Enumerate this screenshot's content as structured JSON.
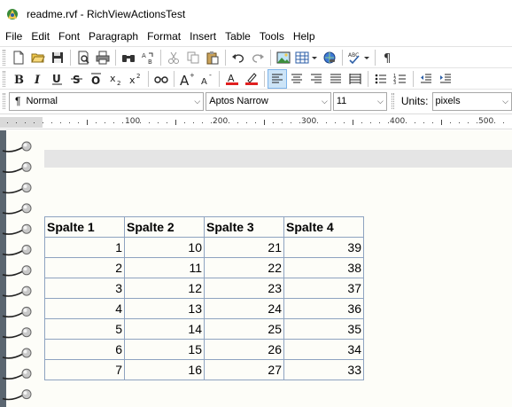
{
  "window": {
    "title": "readme.rvf - RichViewActionsTest"
  },
  "menu": {
    "items": [
      "File",
      "Edit",
      "Font",
      "Paragraph",
      "Format",
      "Insert",
      "Table",
      "Tools",
      "Help"
    ]
  },
  "format_bar": {
    "style_value": "Normal",
    "font_value": "Aptos Narrow",
    "size_value": "11",
    "units_label": "Units:",
    "units_value": "pixels"
  },
  "ruler": {
    "labels": [
      "100",
      "200",
      "300",
      "400",
      "500"
    ]
  },
  "table": {
    "headers": [
      "Spalte 1",
      "Spalte 2",
      "Spalte 3",
      "Spalte 4"
    ],
    "rows": [
      [
        "1",
        "10",
        "21",
        "39"
      ],
      [
        "2",
        "11",
        "22",
        "38"
      ],
      [
        "3",
        "12",
        "23",
        "37"
      ],
      [
        "4",
        "13",
        "24",
        "36"
      ],
      [
        "5",
        "14",
        "25",
        "35"
      ],
      [
        "6",
        "15",
        "26",
        "34"
      ],
      [
        "7",
        "16",
        "27",
        "33"
      ]
    ]
  },
  "colors": {
    "table_border": "#8ea3c0",
    "active_button": "#cce4f7",
    "font_color_bar": "#e02020",
    "highlight_bar": "#e02020"
  }
}
